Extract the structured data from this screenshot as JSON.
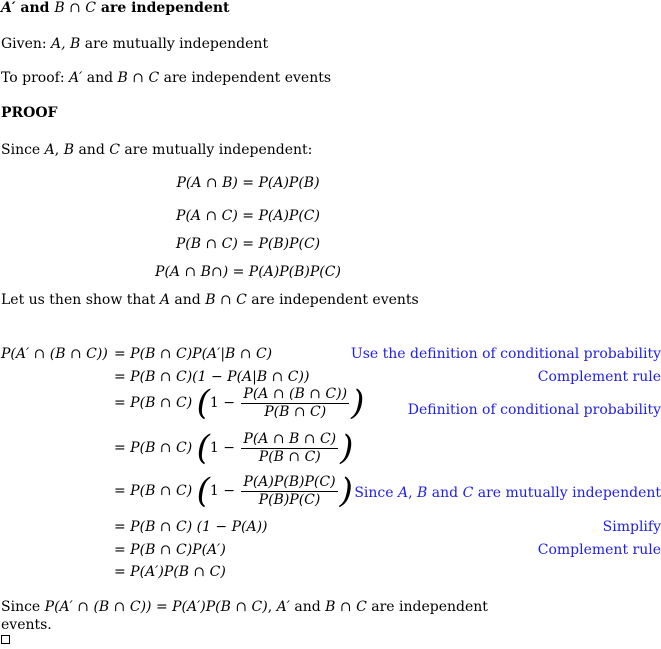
{
  "title": {
    "prefix_math": "A′",
    "text1": " and ",
    "math2": "B ∩ C",
    "text2": " are independent"
  },
  "given": {
    "label": "Given: ",
    "math": "A, B",
    "text": " are mutually independent"
  },
  "to_proof": {
    "label": "To proof: ",
    "math1": "A′",
    "text1": " and ",
    "math2": "B ∩ C",
    "text2": " are independent events"
  },
  "proof_heading": "PROOF",
  "since_line": {
    "text1": "Since ",
    "math1": "A",
    "text2": ", ",
    "math2": "B",
    "text3": " and ",
    "math3": "C",
    "text4": " are mutually independent:"
  },
  "independence_equations": [
    "P(A ∩ B) = P(A)P(B)",
    "P(A ∩ C) = P(A)P(C)",
    "P(B ∩ C) = P(B)P(C)",
    "P(A ∩ B∩) = P(A)P(B)P(C)"
  ],
  "show_line": {
    "text1": "Let us then show that ",
    "math1": "A",
    "text2": " and ",
    "math2": "B ∩ C",
    "text3": " are independent events"
  },
  "derivation": {
    "lhs": "P(A′ ∩ (B ∩ C))",
    "steps": [
      {
        "expr": "= P(B ∩ C)P(A′|B ∩ C)",
        "note": "Use the definition of conditional probability"
      },
      {
        "expr": "= P(B ∩ C)(1 − P(A|B ∩ C))",
        "note": "Complement rule"
      },
      {
        "pre": "= P(B ∩ C)",
        "one_minus": "1 −",
        "num": "P(A ∩ (B ∩ C))",
        "den": "P(B ∩ C)",
        "note": "Definition of conditional probability"
      },
      {
        "pre": "= P(B ∩ C)",
        "one_minus": "1 −",
        "num": "P(A ∩ B ∩ C)",
        "den": "P(B ∩ C)",
        "note": ""
      },
      {
        "pre": "= P(B ∩ C)",
        "one_minus": "1 −",
        "num": "P(A)P(B)P(C)",
        "den": "P(B)P(C)",
        "note_text1": "Since ",
        "note_math1": "A",
        "note_text2": ", ",
        "note_math2": "B",
        "note_text3": " and ",
        "note_math3": "C",
        "note_text4": " are mutually independent"
      },
      {
        "expr": "= P(B ∩ C) (1 − P(A))",
        "note": "Simplify"
      },
      {
        "expr": "= P(B ∩ C)P(A′)",
        "note": "Complement rule"
      },
      {
        "expr": "= P(A′)P(B ∩ C)",
        "note": ""
      }
    ]
  },
  "conclusion": {
    "text1": "Since ",
    "math1": "P(A′ ∩ (B ∩ C)) = P(A′)P(B ∩ C)",
    "text2": ", ",
    "math2": "A′",
    "text3": " and ",
    "math3": "B ∩ C",
    "text4": " are independent",
    "line2": "events."
  },
  "qed_symbol": "end-of-proof-square",
  "colors": {
    "text": "#000000",
    "annotation": "#2020e6",
    "background": "#ffffff"
  }
}
